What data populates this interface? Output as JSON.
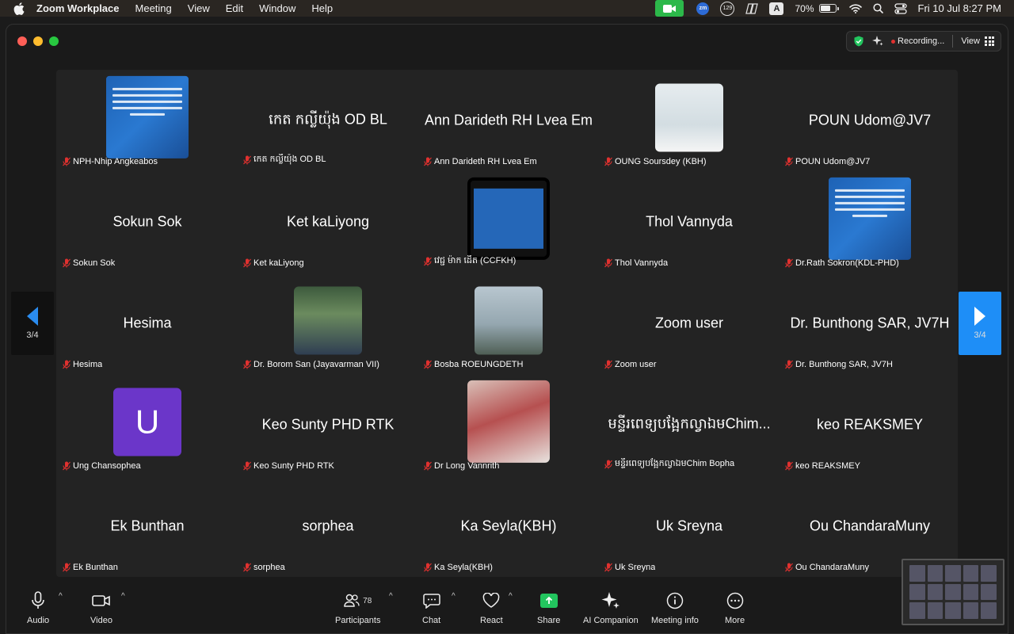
{
  "menubar": {
    "app_name": "Zoom Workplace",
    "items": [
      "Meeting",
      "View",
      "Edit",
      "Window",
      "Help"
    ],
    "badge_count": "129",
    "input_source": "A",
    "battery": "70%",
    "datetime": "Fri 10 Jul  8:27 PM",
    "zm_label": "zm"
  },
  "window": {
    "recording_label": "Recording...",
    "view_label": "View"
  },
  "pager": {
    "left_label": "3/4",
    "right_label": "3/4"
  },
  "tiles": [
    {
      "label": "NPH-Nhip Angkeabos",
      "display": "",
      "avatar": "poster"
    },
    {
      "label": "កេត កល្លីយ៉ុង OD BL",
      "display": "កេត កល្លីយ៉ុង OD BL",
      "avatar": ""
    },
    {
      "label": "Ann Darideth RH Lvea Em",
      "display": "Ann Darideth RH Lvea Em",
      "avatar": ""
    },
    {
      "label": "OUNG Soursdey (KBH)",
      "display": "",
      "avatar": "photo-doc"
    },
    {
      "label": "POUN Udom@JV7",
      "display": "POUN Udom@JV7",
      "avatar": ""
    },
    {
      "label": "Sokun Sok",
      "display": "Sokun Sok",
      "avatar": ""
    },
    {
      "label": "Ket kaLiyong",
      "display": "Ket kaLiyong",
      "avatar": ""
    },
    {
      "label": "វេជ្ជ ម៉ាក ដេីត (CCFKH)",
      "display": "",
      "avatar": "framed"
    },
    {
      "label": "Thol Vannyda",
      "display": "Thol Vannyda",
      "avatar": ""
    },
    {
      "label": "Dr.Rath Sokron(KDL-PHD)",
      "display": "",
      "avatar": "poster"
    },
    {
      "label": "Hesima",
      "display": "Hesima",
      "avatar": ""
    },
    {
      "label": "Dr. Borom San (Jayavarman VII)",
      "display": "",
      "avatar": "photo-man"
    },
    {
      "label": "Bosba ROEUNGDETH",
      "display": "",
      "avatar": "photo-paris"
    },
    {
      "label": "Zoom user",
      "display": "Zoom user",
      "avatar": ""
    },
    {
      "label": "Dr. Bunthong SAR, JV7H",
      "display": "Dr. Bunthong SAR, JV7H",
      "avatar": ""
    },
    {
      "label": "Ung Chansophea",
      "display": "",
      "avatar": "letter",
      "letter": "U"
    },
    {
      "label": "Keo Sunty PHD RTK",
      "display": "Keo Sunty PHD RTK",
      "avatar": ""
    },
    {
      "label": "Dr Long Vannrith",
      "display": "",
      "avatar": "photo-city"
    },
    {
      "label": "មន្ទីរពេទ្យបង្អែកល្វាឯមChim Bopha",
      "display": "មន្ទីរពេទ្យបង្អែកល្វាឯមChim...",
      "avatar": ""
    },
    {
      "label": "keo REAKSMEY",
      "display": "keo REAKSMEY",
      "avatar": ""
    },
    {
      "label": "Ek Bunthan",
      "display": "Ek Bunthan",
      "avatar": ""
    },
    {
      "label": "sorphea",
      "display": "sorphea",
      "avatar": ""
    },
    {
      "label": "Ka Seyla(KBH)",
      "display": "Ka Seyla(KBH)",
      "avatar": ""
    },
    {
      "label": "Uk Sreyna",
      "display": "Uk Sreyna",
      "avatar": ""
    },
    {
      "label": "Ou ChandaraMuny",
      "display": "Ou ChandaraMuny",
      "avatar": ""
    }
  ],
  "toolbar": {
    "audio": "Audio",
    "video": "Video",
    "participants": "Participants",
    "participants_count": "78",
    "chat": "Chat",
    "react": "React",
    "share": "Share",
    "ai_companion": "AI Companion",
    "meeting_info": "Meeting info",
    "more": "More"
  },
  "colors": {
    "accent_blue": "#1e8ef7",
    "share_green": "#22c55e",
    "record_red": "#e0312f",
    "mute_red": "#e0312f"
  }
}
